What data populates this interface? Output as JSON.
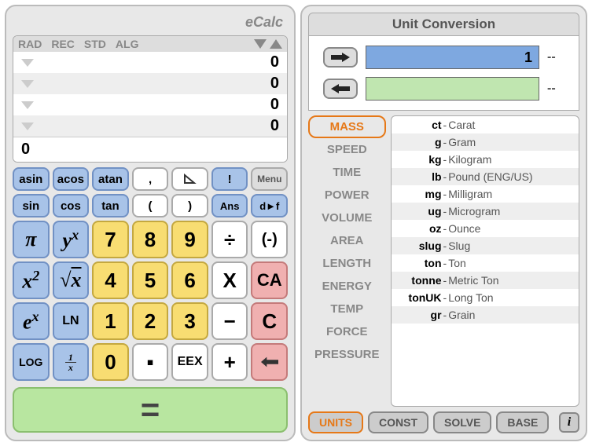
{
  "app": {
    "title": "eCalc"
  },
  "modes": {
    "m0": "RAD",
    "m1": "REC",
    "m2": "STD",
    "m3": "ALG"
  },
  "display": {
    "r0": "0",
    "r1": "0",
    "r2": "0",
    "r3": "0",
    "input": "0"
  },
  "keys": {
    "asin": "asin",
    "acos": "acos",
    "atan": "atan",
    "comma": ",",
    "angle": "∠",
    "fact": "!",
    "menu": "Menu",
    "sin": "sin",
    "cos": "cos",
    "tan": "tan",
    "lp": "(",
    "rp": ")",
    "ans": "Ans",
    "dtof": "d►f",
    "pi": "π",
    "ypx": "yˣ",
    "k7": "7",
    "k8": "8",
    "k9": "9",
    "div": "÷",
    "neg": "(-)",
    "x2": "x²",
    "sqrt": "√x",
    "k4": "4",
    "k5": "5",
    "k6": "6",
    "mul": "X",
    "ca": "CA",
    "ex": "eˣ",
    "ln": "LN",
    "k1": "1",
    "k2": "2",
    "k3": "3",
    "sub": "−",
    "c": "C",
    "log": "LOG",
    "k0": "0",
    "dot": "▪",
    "eex": "EEX",
    "add": "+",
    "eq": "="
  },
  "conv": {
    "title": "Unit Conversion",
    "in_value": "1",
    "in_unit": "--",
    "out_value": "",
    "out_unit": "--",
    "categories": [
      "MASS",
      "SPEED",
      "TIME",
      "POWER",
      "VOLUME",
      "AREA",
      "LENGTH",
      "ENERGY",
      "TEMP",
      "FORCE",
      "PRESSURE"
    ],
    "active_cat": 0,
    "units": [
      {
        "abbr": "ct",
        "name": "Carat"
      },
      {
        "abbr": "g",
        "name": "Gram"
      },
      {
        "abbr": "kg",
        "name": "Kilogram"
      },
      {
        "abbr": "lb",
        "name": "Pound (ENG/US)"
      },
      {
        "abbr": "mg",
        "name": "Milligram"
      },
      {
        "abbr": "ug",
        "name": "Microgram"
      },
      {
        "abbr": "oz",
        "name": "Ounce"
      },
      {
        "abbr": "slug",
        "name": "Slug"
      },
      {
        "abbr": "ton",
        "name": "Ton"
      },
      {
        "abbr": "tonne",
        "name": "Metric Ton"
      },
      {
        "abbr": "tonUK",
        "name": "Long Ton"
      },
      {
        "abbr": "gr",
        "name": "Grain"
      }
    ],
    "tabs": {
      "units": "UNITS",
      "const": "CONST",
      "solve": "SOLVE",
      "base": "BASE"
    },
    "active_tab": "units"
  }
}
